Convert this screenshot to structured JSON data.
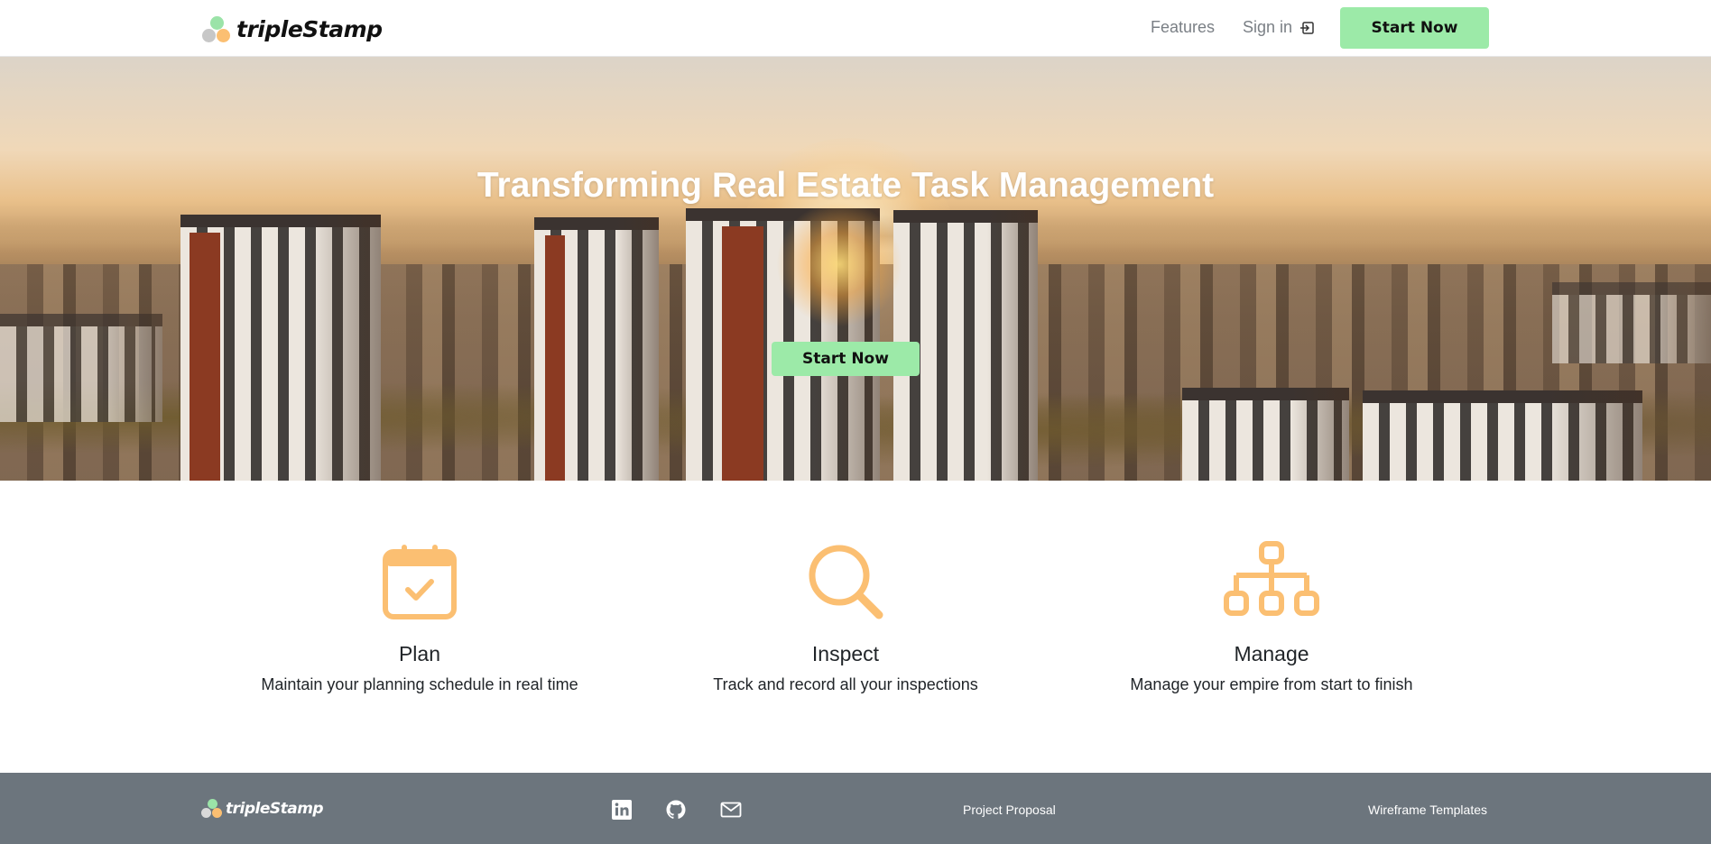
{
  "brand": {
    "name": "tripleStamp"
  },
  "nav": {
    "features": "Features",
    "signin": "Sign in",
    "cta": "Start Now"
  },
  "hero": {
    "title": "Transforming Real Estate Task Management",
    "cta": "Start Now"
  },
  "features": [
    {
      "icon": "calendar-check-icon",
      "title": "Plan",
      "description": "Maintain your planning schedule in real time"
    },
    {
      "icon": "search-icon",
      "title": "Inspect",
      "description": "Track and record all your inspections"
    },
    {
      "icon": "sitemap-icon",
      "title": "Manage",
      "description": "Manage your empire from start to finish"
    }
  ],
  "footer": {
    "brand": "tripleStamp",
    "social": [
      "linkedin-icon",
      "github-icon",
      "mail-icon"
    ],
    "links": [
      "Project Proposal",
      "Wireframe Templates"
    ]
  },
  "colors": {
    "accent_green": "#9ceaa8",
    "icon_orange": "#fbbf72",
    "footer_bg": "#6c757d",
    "nav_text": "#7a7f85"
  }
}
